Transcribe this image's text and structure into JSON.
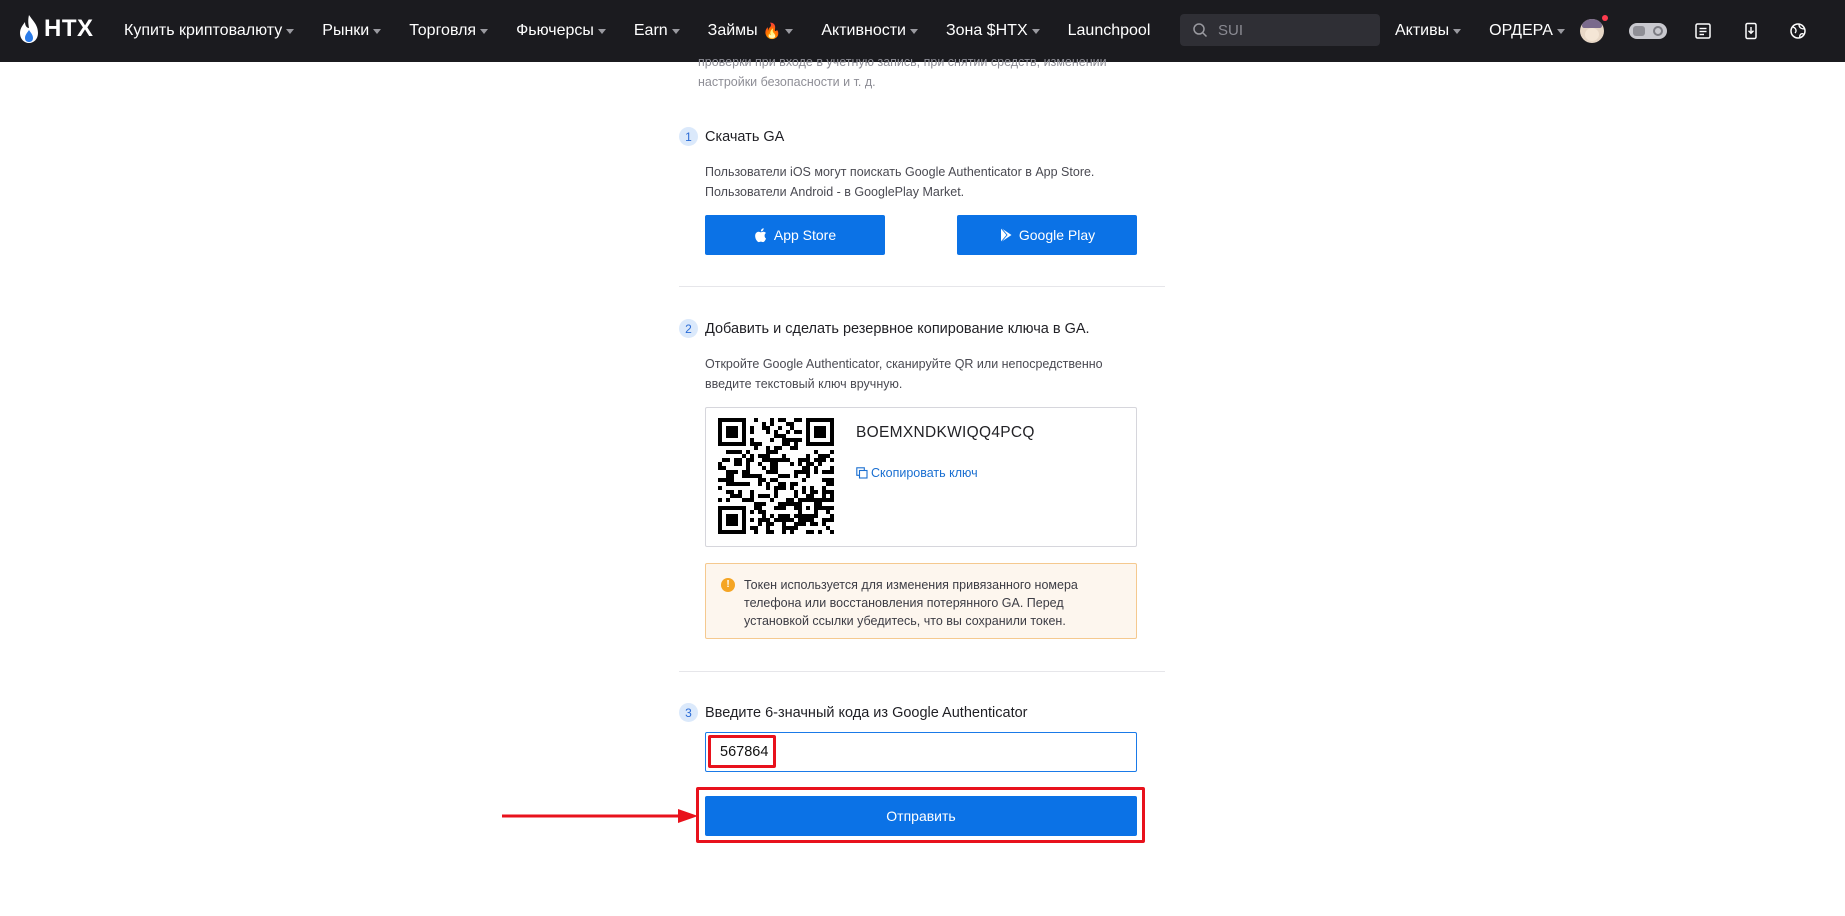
{
  "header": {
    "logo_text": "HTX",
    "nav": [
      {
        "label": "Купить криптовалюту",
        "caret": true
      },
      {
        "label": "Рынки",
        "caret": true
      },
      {
        "label": "Торговля",
        "caret": true
      },
      {
        "label": "Фьючерсы",
        "caret": true
      },
      {
        "label": "Earn",
        "caret": true
      },
      {
        "label": "Займы",
        "caret": true,
        "fire": true
      },
      {
        "label": "Активности",
        "caret": true
      },
      {
        "label": "Зона $HTX",
        "caret": true
      },
      {
        "label": "Launchpool",
        "caret": false
      }
    ],
    "search_placeholder": "SUI",
    "assets_label": "Активы",
    "orders_label": "ОРДЕРА",
    "toggle_count": "0"
  },
  "intro_text": "проверки при входе в учетную запись, при снятии средств, изменении настройки безопасности и т. д.",
  "step1": {
    "num": "1",
    "title": "Скачать GA",
    "desc_line1": "Пользователи iOS могут поискать Google Authenticator в App Store.",
    "desc_line2": "Пользователи Android - в GooglePlay Market.",
    "app_store_label": "App Store",
    "google_play_label": "Google Play"
  },
  "step2": {
    "num": "2",
    "title": "Добавить и сделать резервное копирование ключа в GA.",
    "desc_line1": "Откройте Google Authenticator, сканируйте QR или непосредственно",
    "desc_line2": "введите текстовый ключ вручную.",
    "secret_key": "BOEMXNDKWIQQ4PCQ",
    "copy_label": "Скопировать ключ",
    "warning": "Токен используется для изменения привязанного номера телефона или восстановления потерянного GA. Перед установкой ссылки убедитесь, что вы сохранили токен."
  },
  "step3": {
    "num": "3",
    "title": "Введите 6-значный кода из Google Authenticator",
    "code_value": "567864",
    "submit_label": "Отправить"
  },
  "colors": {
    "accent": "#0b72e6",
    "highlight": "#e8121c",
    "header_bg": "#1b1b1f"
  }
}
